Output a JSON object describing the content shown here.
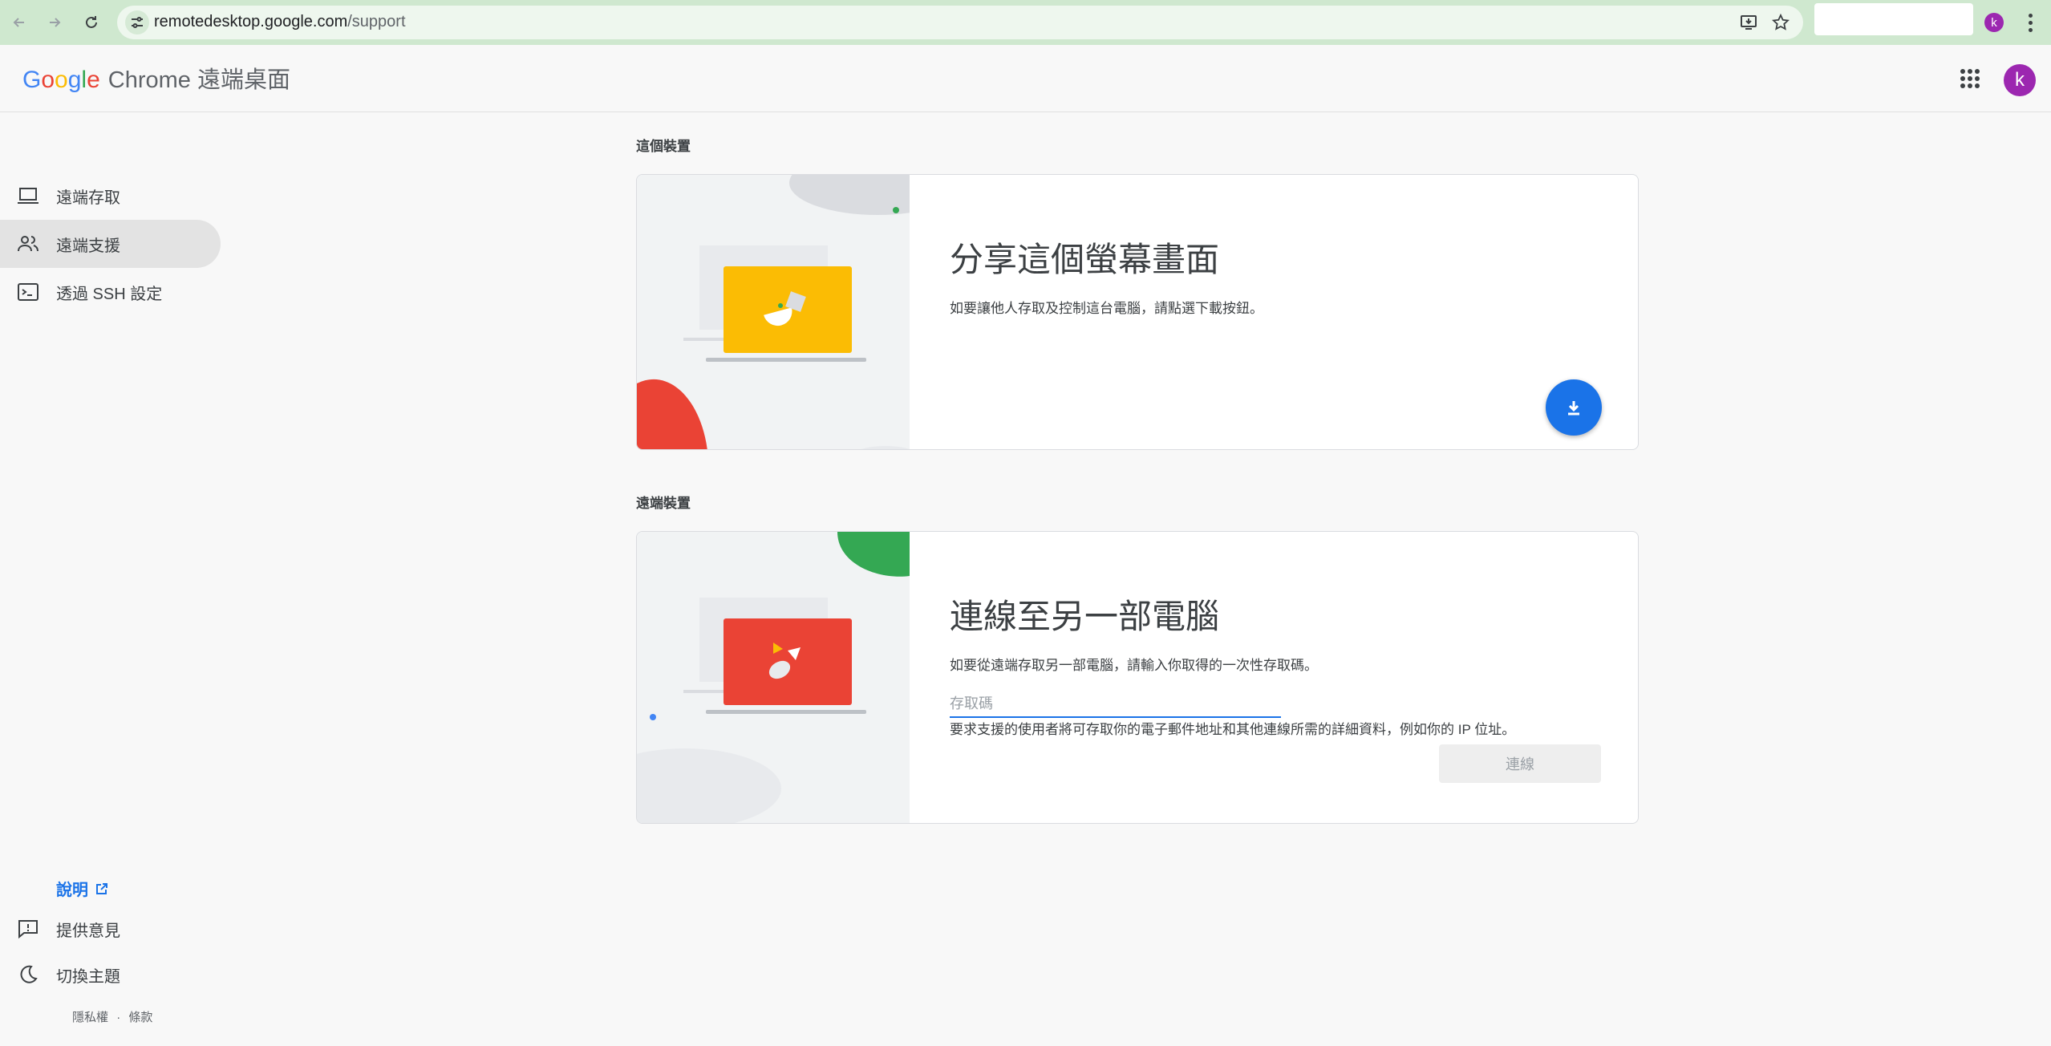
{
  "browser": {
    "url_host": "remotedesktop.google.com",
    "url_path": "/support",
    "avatar_letter": "k"
  },
  "header": {
    "logo_letters": [
      "G",
      "o",
      "o",
      "g",
      "l",
      "e"
    ],
    "app_title": "Chrome 遠端桌面",
    "avatar_letter": "k"
  },
  "sidebar": {
    "items": [
      {
        "label": "遠端存取",
        "icon": "laptop-icon",
        "active": false
      },
      {
        "label": "遠端支援",
        "icon": "people-icon",
        "active": true
      },
      {
        "label": "透過 SSH 設定",
        "icon": "terminal-icon",
        "active": false
      }
    ],
    "help_label": "說明",
    "feedback_label": "提供意見",
    "theme_label": "切換主題",
    "privacy_label": "隱私權",
    "separator": "·",
    "terms_label": "條款"
  },
  "this_device": {
    "section_label": "這個裝置",
    "title": "分享這個螢幕畫面",
    "description": "如要讓他人存取及控制這台電腦，請點選下載按鈕。"
  },
  "remote_device": {
    "section_label": "遠端裝置",
    "title": "連線至另一部電腦",
    "description": "如要從遠端存取另一部電腦，請輸入你取得的一次性存取碼。",
    "input_placeholder": "存取碼",
    "input_value": "",
    "notice": "要求支援的使用者將可存取你的電子郵件地址和其他連線所需的詳細資料，例如你的 IP 位址。",
    "connect_label": "連線"
  },
  "colors": {
    "accent": "#1a73e8",
    "share_screen": "#fbbc04",
    "connect_screen": "#ea4335",
    "avatar": "#9c27b0"
  }
}
